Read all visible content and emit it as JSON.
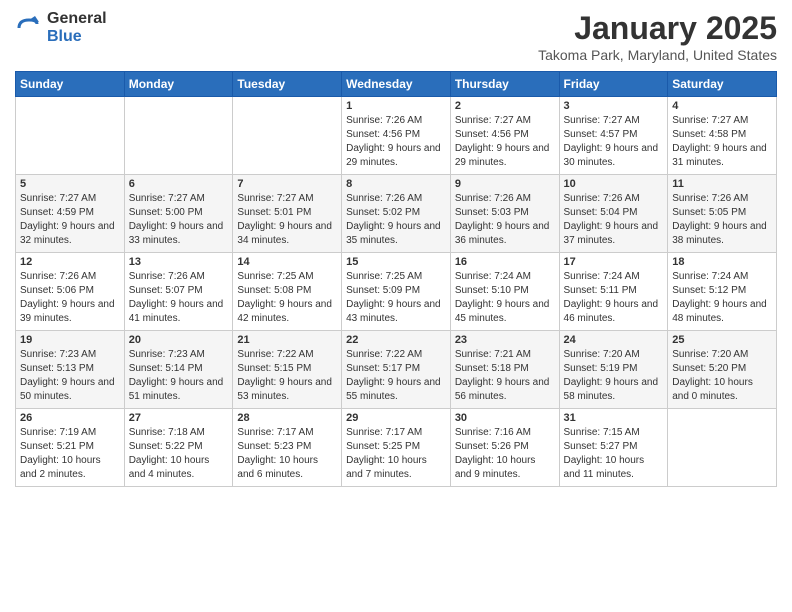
{
  "logo": {
    "general": "General",
    "blue": "Blue"
  },
  "header": {
    "month": "January 2025",
    "location": "Takoma Park, Maryland, United States"
  },
  "weekdays": [
    "Sunday",
    "Monday",
    "Tuesday",
    "Wednesday",
    "Thursday",
    "Friday",
    "Saturday"
  ],
  "weeks": [
    [
      {
        "day": "",
        "sunrise": "",
        "sunset": "",
        "daylight": ""
      },
      {
        "day": "",
        "sunrise": "",
        "sunset": "",
        "daylight": ""
      },
      {
        "day": "",
        "sunrise": "",
        "sunset": "",
        "daylight": ""
      },
      {
        "day": "1",
        "sunrise": "Sunrise: 7:26 AM",
        "sunset": "Sunset: 4:56 PM",
        "daylight": "Daylight: 9 hours and 29 minutes."
      },
      {
        "day": "2",
        "sunrise": "Sunrise: 7:27 AM",
        "sunset": "Sunset: 4:56 PM",
        "daylight": "Daylight: 9 hours and 29 minutes."
      },
      {
        "day": "3",
        "sunrise": "Sunrise: 7:27 AM",
        "sunset": "Sunset: 4:57 PM",
        "daylight": "Daylight: 9 hours and 30 minutes."
      },
      {
        "day": "4",
        "sunrise": "Sunrise: 7:27 AM",
        "sunset": "Sunset: 4:58 PM",
        "daylight": "Daylight: 9 hours and 31 minutes."
      }
    ],
    [
      {
        "day": "5",
        "sunrise": "Sunrise: 7:27 AM",
        "sunset": "Sunset: 4:59 PM",
        "daylight": "Daylight: 9 hours and 32 minutes."
      },
      {
        "day": "6",
        "sunrise": "Sunrise: 7:27 AM",
        "sunset": "Sunset: 5:00 PM",
        "daylight": "Daylight: 9 hours and 33 minutes."
      },
      {
        "day": "7",
        "sunrise": "Sunrise: 7:27 AM",
        "sunset": "Sunset: 5:01 PM",
        "daylight": "Daylight: 9 hours and 34 minutes."
      },
      {
        "day": "8",
        "sunrise": "Sunrise: 7:26 AM",
        "sunset": "Sunset: 5:02 PM",
        "daylight": "Daylight: 9 hours and 35 minutes."
      },
      {
        "day": "9",
        "sunrise": "Sunrise: 7:26 AM",
        "sunset": "Sunset: 5:03 PM",
        "daylight": "Daylight: 9 hours and 36 minutes."
      },
      {
        "day": "10",
        "sunrise": "Sunrise: 7:26 AM",
        "sunset": "Sunset: 5:04 PM",
        "daylight": "Daylight: 9 hours and 37 minutes."
      },
      {
        "day": "11",
        "sunrise": "Sunrise: 7:26 AM",
        "sunset": "Sunset: 5:05 PM",
        "daylight": "Daylight: 9 hours and 38 minutes."
      }
    ],
    [
      {
        "day": "12",
        "sunrise": "Sunrise: 7:26 AM",
        "sunset": "Sunset: 5:06 PM",
        "daylight": "Daylight: 9 hours and 39 minutes."
      },
      {
        "day": "13",
        "sunrise": "Sunrise: 7:26 AM",
        "sunset": "Sunset: 5:07 PM",
        "daylight": "Daylight: 9 hours and 41 minutes."
      },
      {
        "day": "14",
        "sunrise": "Sunrise: 7:25 AM",
        "sunset": "Sunset: 5:08 PM",
        "daylight": "Daylight: 9 hours and 42 minutes."
      },
      {
        "day": "15",
        "sunrise": "Sunrise: 7:25 AM",
        "sunset": "Sunset: 5:09 PM",
        "daylight": "Daylight: 9 hours and 43 minutes."
      },
      {
        "day": "16",
        "sunrise": "Sunrise: 7:24 AM",
        "sunset": "Sunset: 5:10 PM",
        "daylight": "Daylight: 9 hours and 45 minutes."
      },
      {
        "day": "17",
        "sunrise": "Sunrise: 7:24 AM",
        "sunset": "Sunset: 5:11 PM",
        "daylight": "Daylight: 9 hours and 46 minutes."
      },
      {
        "day": "18",
        "sunrise": "Sunrise: 7:24 AM",
        "sunset": "Sunset: 5:12 PM",
        "daylight": "Daylight: 9 hours and 48 minutes."
      }
    ],
    [
      {
        "day": "19",
        "sunrise": "Sunrise: 7:23 AM",
        "sunset": "Sunset: 5:13 PM",
        "daylight": "Daylight: 9 hours and 50 minutes."
      },
      {
        "day": "20",
        "sunrise": "Sunrise: 7:23 AM",
        "sunset": "Sunset: 5:14 PM",
        "daylight": "Daylight: 9 hours and 51 minutes."
      },
      {
        "day": "21",
        "sunrise": "Sunrise: 7:22 AM",
        "sunset": "Sunset: 5:15 PM",
        "daylight": "Daylight: 9 hours and 53 minutes."
      },
      {
        "day": "22",
        "sunrise": "Sunrise: 7:22 AM",
        "sunset": "Sunset: 5:17 PM",
        "daylight": "Daylight: 9 hours and 55 minutes."
      },
      {
        "day": "23",
        "sunrise": "Sunrise: 7:21 AM",
        "sunset": "Sunset: 5:18 PM",
        "daylight": "Daylight: 9 hours and 56 minutes."
      },
      {
        "day": "24",
        "sunrise": "Sunrise: 7:20 AM",
        "sunset": "Sunset: 5:19 PM",
        "daylight": "Daylight: 9 hours and 58 minutes."
      },
      {
        "day": "25",
        "sunrise": "Sunrise: 7:20 AM",
        "sunset": "Sunset: 5:20 PM",
        "daylight": "Daylight: 10 hours and 0 minutes."
      }
    ],
    [
      {
        "day": "26",
        "sunrise": "Sunrise: 7:19 AM",
        "sunset": "Sunset: 5:21 PM",
        "daylight": "Daylight: 10 hours and 2 minutes."
      },
      {
        "day": "27",
        "sunrise": "Sunrise: 7:18 AM",
        "sunset": "Sunset: 5:22 PM",
        "daylight": "Daylight: 10 hours and 4 minutes."
      },
      {
        "day": "28",
        "sunrise": "Sunrise: 7:17 AM",
        "sunset": "Sunset: 5:23 PM",
        "daylight": "Daylight: 10 hours and 6 minutes."
      },
      {
        "day": "29",
        "sunrise": "Sunrise: 7:17 AM",
        "sunset": "Sunset: 5:25 PM",
        "daylight": "Daylight: 10 hours and 7 minutes."
      },
      {
        "day": "30",
        "sunrise": "Sunrise: 7:16 AM",
        "sunset": "Sunset: 5:26 PM",
        "daylight": "Daylight: 10 hours and 9 minutes."
      },
      {
        "day": "31",
        "sunrise": "Sunrise: 7:15 AM",
        "sunset": "Sunset: 5:27 PM",
        "daylight": "Daylight: 10 hours and 11 minutes."
      },
      {
        "day": "",
        "sunrise": "",
        "sunset": "",
        "daylight": ""
      }
    ]
  ]
}
